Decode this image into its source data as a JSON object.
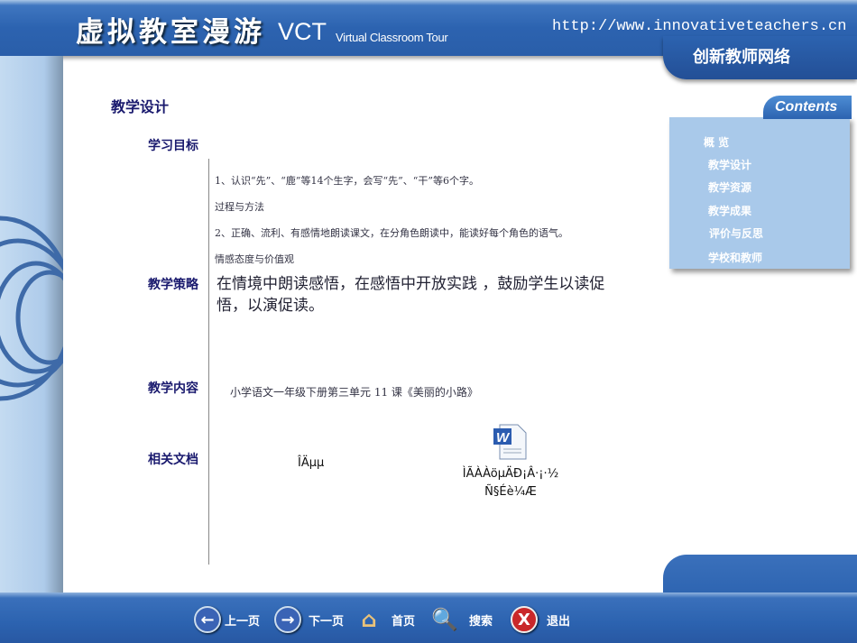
{
  "header": {
    "title_cn": "虚拟教室漫游",
    "title_vct": "VCT",
    "title_en": "Virtual Classroom Tour",
    "url": "http://www.innovativeteachers.cn",
    "org": "创新教师网络"
  },
  "section_title": "教学设计",
  "labels": {
    "goals": "学习目标",
    "strategy": "教学策略",
    "content": "教学内容",
    "docs": "相关文档"
  },
  "goals": [
    "1、认识“先”、“鹿”等14个生字，会写“先”、“干”等6个字。",
    "过程与方法",
    "2、正确、流利、有感情地朗读课文，在分角色朗读中，能读好每个角色的语气。",
    "情感态度与价值观"
  ],
  "strategy": "在情境中朗读感悟，在感悟中开放实践 ，鼓励学生以读促悟，以演促读。",
  "content": "小学语文一年级下册第三单元 11 课《美丽的小路》",
  "docs": {
    "doc1": "ÎÄµµ",
    "doc2_line1": "ÌÃÀÀöµÄÐ¡Â·¡·½",
    "doc2_line2": "Ñ§Éè¼Æ"
  },
  "contents": {
    "tab": "Contents",
    "items": [
      "概 览",
      "教学设计",
      "教学资源",
      "教学成果",
      "评价与反思",
      "学校和教师"
    ]
  },
  "nav": {
    "prev": "上一页",
    "next": "下一页",
    "home": "首页",
    "search": "搜索",
    "exit": "退出"
  }
}
